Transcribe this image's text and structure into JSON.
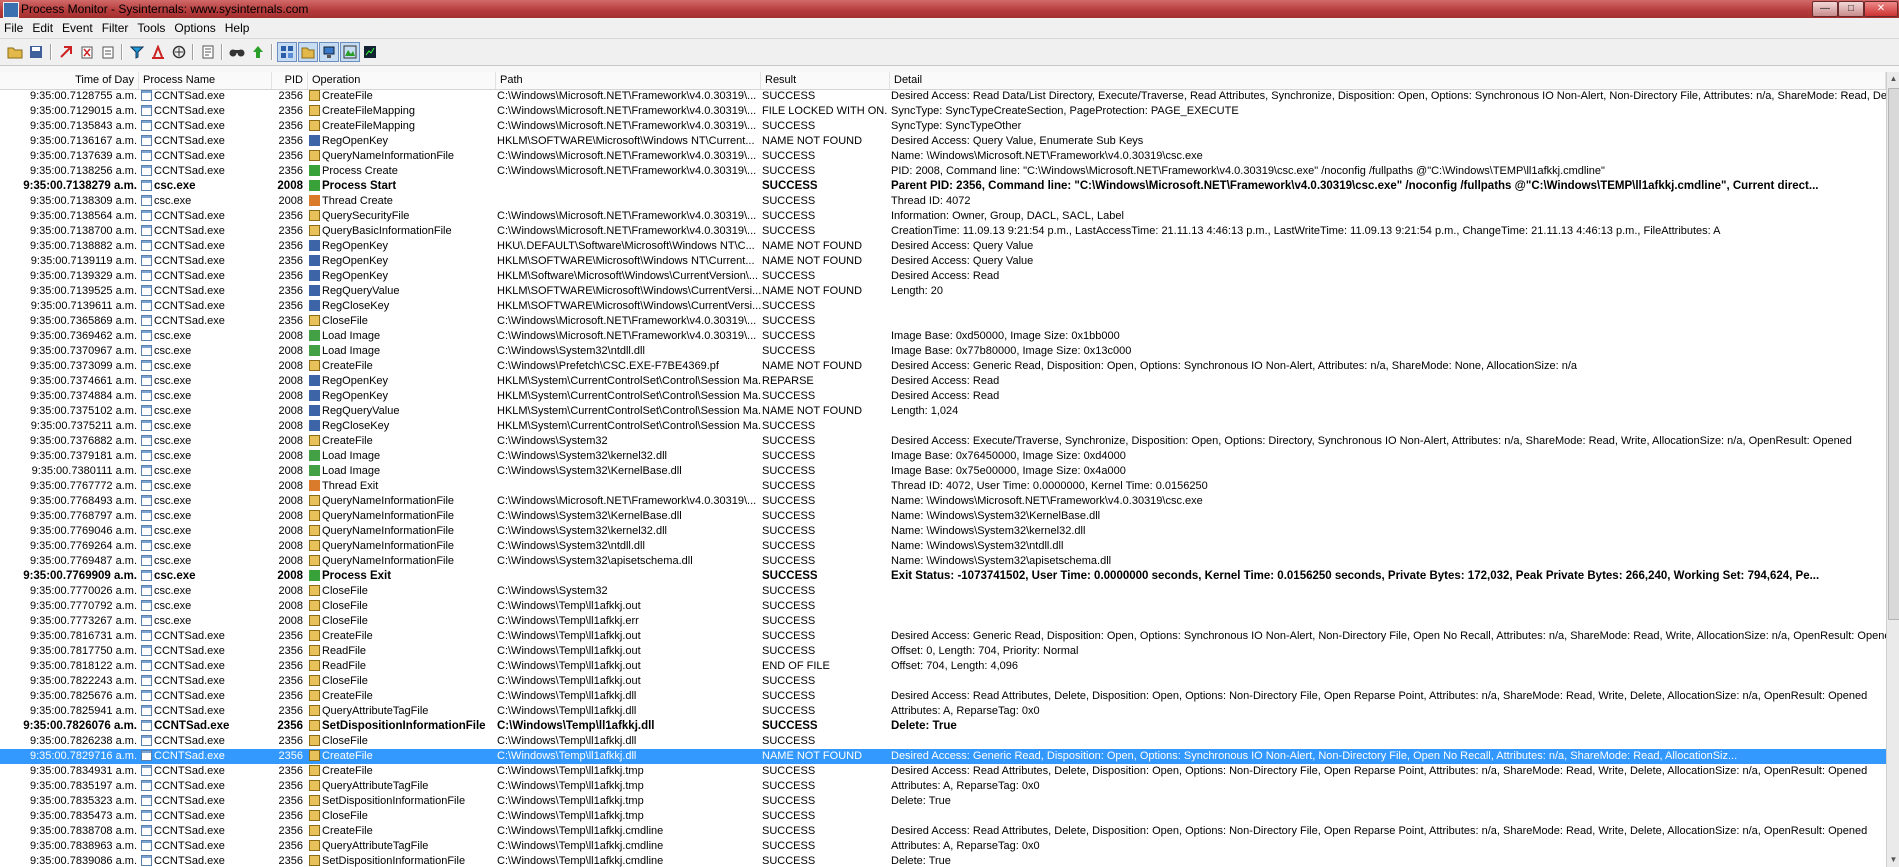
{
  "window": {
    "title": "Process Monitor - Sysinternals: www.sysinternals.com"
  },
  "menu": [
    "File",
    "Edit",
    "Event",
    "Filter",
    "Tools",
    "Options",
    "Help"
  ],
  "columns": {
    "time": "Time of Day",
    "process": "Process Name",
    "pid": "PID",
    "operation": "Operation",
    "path": "Path",
    "result": "Result",
    "detail": "Detail"
  },
  "toolbar": [
    "open-icon",
    "save-icon",
    "autoscroll-icon",
    "clear-icon",
    "filter-icon",
    "highlight-icon",
    "include-icon",
    "jump-icon",
    "find-icon",
    "jump-to-icon",
    "registry-icon",
    "filesystem-icon",
    "network-icon",
    "process-icon",
    "profiling-icon"
  ],
  "colors": {
    "selected_row": "#3399ff",
    "titlebar": "#b53a3a"
  },
  "rows": [
    {
      "time": "9:35:00.7128755 a.m.",
      "process": "CCNTSad.exe",
      "pid": "2356",
      "op": "CreateFile",
      "opIcon": "file",
      "path": "C:\\Windows\\Microsoft.NET\\Framework\\v4.0.30319\\...",
      "result": "SUCCESS",
      "detail": "Desired Access: Read Data/List Directory, Execute/Traverse, Read Attributes, Synchronize, Disposition: Open, Options: Synchronous IO Non-Alert, Non-Directory File, Attributes: n/a, ShareMode: Read, Delete..."
    },
    {
      "time": "9:35:00.7129015 a.m.",
      "process": "CCNTSad.exe",
      "pid": "2356",
      "op": "CreateFileMapping",
      "opIcon": "file",
      "path": "C:\\Windows\\Microsoft.NET\\Framework\\v4.0.30319\\...",
      "result": "FILE LOCKED WITH ON...",
      "detail": "SyncType: SyncTypeCreateSection, PageProtection: PAGE_EXECUTE"
    },
    {
      "time": "9:35:00.7135843 a.m.",
      "process": "CCNTSad.exe",
      "pid": "2356",
      "op": "CreateFileMapping",
      "opIcon": "file",
      "path": "C:\\Windows\\Microsoft.NET\\Framework\\v4.0.30319\\...",
      "result": "SUCCESS",
      "detail": "SyncType: SyncTypeOther"
    },
    {
      "time": "9:35:00.7136167 a.m.",
      "process": "CCNTSad.exe",
      "pid": "2356",
      "op": "RegOpenKey",
      "opIcon": "reg",
      "path": "HKLM\\SOFTWARE\\Microsoft\\Windows NT\\Current...",
      "result": "NAME NOT FOUND",
      "detail": "Desired Access: Query Value, Enumerate Sub Keys"
    },
    {
      "time": "9:35:00.7137639 a.m.",
      "process": "CCNTSad.exe",
      "pid": "2356",
      "op": "QueryNameInformationFile",
      "opIcon": "file",
      "path": "C:\\Windows\\Microsoft.NET\\Framework\\v4.0.30319\\...",
      "result": "SUCCESS",
      "detail": "Name: \\Windows\\Microsoft.NET\\Framework\\v4.0.30319\\csc.exe"
    },
    {
      "time": "9:35:00.7138256 a.m.",
      "process": "CCNTSad.exe",
      "pid": "2356",
      "op": "Process Create",
      "opIcon": "proc",
      "path": "C:\\Windows\\Microsoft.NET\\Framework\\v4.0.30319\\...",
      "result": "SUCCESS",
      "detail": "PID: 2008, Command line: \"C:\\Windows\\Microsoft.NET\\Framework\\v4.0.30319\\csc.exe\" /noconfig /fullpaths @\"C:\\Windows\\TEMP\\ll1afkkj.cmdline\""
    },
    {
      "time": "9:35:00.7138279 a.m.",
      "process": "csc.exe",
      "pid": "2008",
      "op": "Process Start",
      "opIcon": "proc",
      "path": "",
      "result": "SUCCESS",
      "detail": "Parent PID: 2356, Command line: \"C:\\Windows\\Microsoft.NET\\Framework\\v4.0.30319\\csc.exe\" /noconfig /fullpaths @\"C:\\Windows\\TEMP\\ll1afkkj.cmdline\", Current direct...",
      "bold": true
    },
    {
      "time": "9:35:00.7138309 a.m.",
      "process": "csc.exe",
      "pid": "2008",
      "op": "Thread Create",
      "opIcon": "thread",
      "path": "",
      "result": "SUCCESS",
      "detail": "Thread ID: 4072"
    },
    {
      "time": "9:35:00.7138564 a.m.",
      "process": "CCNTSad.exe",
      "pid": "2356",
      "op": "QuerySecurityFile",
      "opIcon": "file",
      "path": "C:\\Windows\\Microsoft.NET\\Framework\\v4.0.30319\\...",
      "result": "SUCCESS",
      "detail": "Information: Owner, Group, DACL, SACL, Label"
    },
    {
      "time": "9:35:00.7138700 a.m.",
      "process": "CCNTSad.exe",
      "pid": "2356",
      "op": "QueryBasicInformationFile",
      "opIcon": "file",
      "path": "C:\\Windows\\Microsoft.NET\\Framework\\v4.0.30319\\...",
      "result": "SUCCESS",
      "detail": "CreationTime: 11.09.13 9:21:54 p.m., LastAccessTime: 21.11.13 4:46:13 p.m., LastWriteTime: 11.09.13 9:21:54 p.m., ChangeTime: 21.11.13 4:46:13 p.m., FileAttributes: A"
    },
    {
      "time": "9:35:00.7138882 a.m.",
      "process": "CCNTSad.exe",
      "pid": "2356",
      "op": "RegOpenKey",
      "opIcon": "reg",
      "path": "HKU\\.DEFAULT\\Software\\Microsoft\\Windows NT\\C...",
      "result": "NAME NOT FOUND",
      "detail": "Desired Access: Query Value"
    },
    {
      "time": "9:35:00.7139119 a.m.",
      "process": "CCNTSad.exe",
      "pid": "2356",
      "op": "RegOpenKey",
      "opIcon": "reg",
      "path": "HKLM\\SOFTWARE\\Microsoft\\Windows NT\\Current...",
      "result": "NAME NOT FOUND",
      "detail": "Desired Access: Query Value"
    },
    {
      "time": "9:35:00.7139329 a.m.",
      "process": "CCNTSad.exe",
      "pid": "2356",
      "op": "RegOpenKey",
      "opIcon": "reg",
      "path": "HKLM\\Software\\Microsoft\\Windows\\CurrentVersion\\...",
      "result": "SUCCESS",
      "detail": "Desired Access: Read"
    },
    {
      "time": "9:35:00.7139525 a.m.",
      "process": "CCNTSad.exe",
      "pid": "2356",
      "op": "RegQueryValue",
      "opIcon": "reg",
      "path": "HKLM\\SOFTWARE\\Microsoft\\Windows\\CurrentVersi...",
      "result": "NAME NOT FOUND",
      "detail": "Length: 20"
    },
    {
      "time": "9:35:00.7139611 a.m.",
      "process": "CCNTSad.exe",
      "pid": "2356",
      "op": "RegCloseKey",
      "opIcon": "reg",
      "path": "HKLM\\SOFTWARE\\Microsoft\\Windows\\CurrentVersi...",
      "result": "SUCCESS",
      "detail": ""
    },
    {
      "time": "9:35:00.7365869 a.m.",
      "process": "CCNTSad.exe",
      "pid": "2356",
      "op": "CloseFile",
      "opIcon": "file",
      "path": "C:\\Windows\\Microsoft.NET\\Framework\\v4.0.30319\\...",
      "result": "SUCCESS",
      "detail": ""
    },
    {
      "time": "9:35:00.7369462 a.m.",
      "process": "csc.exe",
      "pid": "2008",
      "op": "Load Image",
      "opIcon": "img",
      "path": "C:\\Windows\\Microsoft.NET\\Framework\\v4.0.30319\\...",
      "result": "SUCCESS",
      "detail": "Image Base: 0xd50000, Image Size: 0x1bb000"
    },
    {
      "time": "9:35:00.7370967 a.m.",
      "process": "csc.exe",
      "pid": "2008",
      "op": "Load Image",
      "opIcon": "img",
      "path": "C:\\Windows\\System32\\ntdll.dll",
      "result": "SUCCESS",
      "detail": "Image Base: 0x77b80000, Image Size: 0x13c000"
    },
    {
      "time": "9:35:00.7373099 a.m.",
      "process": "csc.exe",
      "pid": "2008",
      "op": "CreateFile",
      "opIcon": "file",
      "path": "C:\\Windows\\Prefetch\\CSC.EXE-F7BE4369.pf",
      "result": "NAME NOT FOUND",
      "detail": "Desired Access: Generic Read, Disposition: Open, Options: Synchronous IO Non-Alert, Attributes: n/a, ShareMode: None, AllocationSize: n/a"
    },
    {
      "time": "9:35:00.7374661 a.m.",
      "process": "csc.exe",
      "pid": "2008",
      "op": "RegOpenKey",
      "opIcon": "reg",
      "path": "HKLM\\System\\CurrentControlSet\\Control\\Session Ma...",
      "result": "REPARSE",
      "detail": "Desired Access: Read"
    },
    {
      "time": "9:35:00.7374884 a.m.",
      "process": "csc.exe",
      "pid": "2008",
      "op": "RegOpenKey",
      "opIcon": "reg",
      "path": "HKLM\\System\\CurrentControlSet\\Control\\Session Ma...",
      "result": "SUCCESS",
      "detail": "Desired Access: Read"
    },
    {
      "time": "9:35:00.7375102 a.m.",
      "process": "csc.exe",
      "pid": "2008",
      "op": "RegQueryValue",
      "opIcon": "reg",
      "path": "HKLM\\System\\CurrentControlSet\\Control\\Session Ma...",
      "result": "NAME NOT FOUND",
      "detail": "Length: 1,024"
    },
    {
      "time": "9:35:00.7375211 a.m.",
      "process": "csc.exe",
      "pid": "2008",
      "op": "RegCloseKey",
      "opIcon": "reg",
      "path": "HKLM\\System\\CurrentControlSet\\Control\\Session Ma...",
      "result": "SUCCESS",
      "detail": ""
    },
    {
      "time": "9:35:00.7376882 a.m.",
      "process": "csc.exe",
      "pid": "2008",
      "op": "CreateFile",
      "opIcon": "file",
      "path": "C:\\Windows\\System32",
      "result": "SUCCESS",
      "detail": "Desired Access: Execute/Traverse, Synchronize, Disposition: Open, Options: Directory, Synchronous IO Non-Alert, Attributes: n/a, ShareMode: Read, Write, AllocationSize: n/a, OpenResult: Opened"
    },
    {
      "time": "9:35:00.7379181 a.m.",
      "process": "csc.exe",
      "pid": "2008",
      "op": "Load Image",
      "opIcon": "img",
      "path": "C:\\Windows\\System32\\kernel32.dll",
      "result": "SUCCESS",
      "detail": "Image Base: 0x76450000, Image Size: 0xd4000"
    },
    {
      "time": "9:35:00.7380111 a.m.",
      "process": "csc.exe",
      "pid": "2008",
      "op": "Load Image",
      "opIcon": "img",
      "path": "C:\\Windows\\System32\\KernelBase.dll",
      "result": "SUCCESS",
      "detail": "Image Base: 0x75e00000, Image Size: 0x4a000"
    },
    {
      "time": "9:35:00.7767772 a.m.",
      "process": "csc.exe",
      "pid": "2008",
      "op": "Thread Exit",
      "opIcon": "thread",
      "path": "",
      "result": "SUCCESS",
      "detail": "Thread ID: 4072, User Time: 0.0000000, Kernel Time: 0.0156250"
    },
    {
      "time": "9:35:00.7768493 a.m.",
      "process": "csc.exe",
      "pid": "2008",
      "op": "QueryNameInformationFile",
      "opIcon": "file",
      "path": "C:\\Windows\\Microsoft.NET\\Framework\\v4.0.30319\\...",
      "result": "SUCCESS",
      "detail": "Name: \\Windows\\Microsoft.NET\\Framework\\v4.0.30319\\csc.exe"
    },
    {
      "time": "9:35:00.7768797 a.m.",
      "process": "csc.exe",
      "pid": "2008",
      "op": "QueryNameInformationFile",
      "opIcon": "file",
      "path": "C:\\Windows\\System32\\KernelBase.dll",
      "result": "SUCCESS",
      "detail": "Name: \\Windows\\System32\\KernelBase.dll"
    },
    {
      "time": "9:35:00.7769046 a.m.",
      "process": "csc.exe",
      "pid": "2008",
      "op": "QueryNameInformationFile",
      "opIcon": "file",
      "path": "C:\\Windows\\System32\\kernel32.dll",
      "result": "SUCCESS",
      "detail": "Name: \\Windows\\System32\\kernel32.dll"
    },
    {
      "time": "9:35:00.7769264 a.m.",
      "process": "csc.exe",
      "pid": "2008",
      "op": "QueryNameInformationFile",
      "opIcon": "file",
      "path": "C:\\Windows\\System32\\ntdll.dll",
      "result": "SUCCESS",
      "detail": "Name: \\Windows\\System32\\ntdll.dll"
    },
    {
      "time": "9:35:00.7769487 a.m.",
      "process": "csc.exe",
      "pid": "2008",
      "op": "QueryNameInformationFile",
      "opIcon": "file",
      "path": "C:\\Windows\\System32\\apisetschema.dll",
      "result": "SUCCESS",
      "detail": "Name: \\Windows\\System32\\apisetschema.dll"
    },
    {
      "time": "9:35:00.7769909 a.m.",
      "process": "csc.exe",
      "pid": "2008",
      "op": "Process Exit",
      "opIcon": "proc",
      "path": "",
      "result": "SUCCESS",
      "detail": "Exit Status: -1073741502, User Time: 0.0000000 seconds, Kernel Time: 0.0156250 seconds, Private Bytes: 172,032, Peak Private Bytes: 266,240, Working Set: 794,624, Pe...",
      "bold": true
    },
    {
      "time": "9:35:00.7770026 a.m.",
      "process": "csc.exe",
      "pid": "2008",
      "op": "CloseFile",
      "opIcon": "file",
      "path": "C:\\Windows\\System32",
      "result": "SUCCESS",
      "detail": ""
    },
    {
      "time": "9:35:00.7770792 a.m.",
      "process": "csc.exe",
      "pid": "2008",
      "op": "CloseFile",
      "opIcon": "file",
      "path": "C:\\Windows\\Temp\\ll1afkkj.out",
      "result": "SUCCESS",
      "detail": ""
    },
    {
      "time": "9:35:00.7773267 a.m.",
      "process": "csc.exe",
      "pid": "2008",
      "op": "CloseFile",
      "opIcon": "file",
      "path": "C:\\Windows\\Temp\\ll1afkkj.err",
      "result": "SUCCESS",
      "detail": ""
    },
    {
      "time": "9:35:00.7816731 a.m.",
      "process": "CCNTSad.exe",
      "pid": "2356",
      "op": "CreateFile",
      "opIcon": "file",
      "path": "C:\\Windows\\Temp\\ll1afkkj.out",
      "result": "SUCCESS",
      "detail": "Desired Access: Generic Read, Disposition: Open, Options: Synchronous IO Non-Alert, Non-Directory File, Open No Recall, Attributes: n/a, ShareMode: Read, Write, AllocationSize: n/a, OpenResult: Opened"
    },
    {
      "time": "9:35:00.7817750 a.m.",
      "process": "CCNTSad.exe",
      "pid": "2356",
      "op": "ReadFile",
      "opIcon": "file",
      "path": "C:\\Windows\\Temp\\ll1afkkj.out",
      "result": "SUCCESS",
      "detail": "Offset: 0, Length: 704, Priority: Normal"
    },
    {
      "time": "9:35:00.7818122 a.m.",
      "process": "CCNTSad.exe",
      "pid": "2356",
      "op": "ReadFile",
      "opIcon": "file",
      "path": "C:\\Windows\\Temp\\ll1afkkj.out",
      "result": "END OF FILE",
      "detail": "Offset: 704, Length: 4,096"
    },
    {
      "time": "9:35:00.7822243 a.m.",
      "process": "CCNTSad.exe",
      "pid": "2356",
      "op": "CloseFile",
      "opIcon": "file",
      "path": "C:\\Windows\\Temp\\ll1afkkj.out",
      "result": "SUCCESS",
      "detail": ""
    },
    {
      "time": "9:35:00.7825676 a.m.",
      "process": "CCNTSad.exe",
      "pid": "2356",
      "op": "CreateFile",
      "opIcon": "file",
      "path": "C:\\Windows\\Temp\\ll1afkkj.dll",
      "result": "SUCCESS",
      "detail": "Desired Access: Read Attributes, Delete, Disposition: Open, Options: Non-Directory File, Open Reparse Point, Attributes: n/a, ShareMode: Read, Write, Delete, AllocationSize: n/a, OpenResult: Opened"
    },
    {
      "time": "9:35:00.7825941 a.m.",
      "process": "CCNTSad.exe",
      "pid": "2356",
      "op": "QueryAttributeTagFile",
      "opIcon": "file",
      "path": "C:\\Windows\\Temp\\ll1afkkj.dll",
      "result": "SUCCESS",
      "detail": "Attributes: A, ReparseTag: 0x0"
    },
    {
      "time": "9:35:00.7826076 a.m.",
      "process": "CCNTSad.exe",
      "pid": "2356",
      "op": "SetDispositionInformationFile",
      "opIcon": "file",
      "path": "C:\\Windows\\Temp\\ll1afkkj.dll",
      "result": "SUCCESS",
      "detail": "Delete: True",
      "bold": true
    },
    {
      "time": "9:35:00.7826238 a.m.",
      "process": "CCNTSad.exe",
      "pid": "2356",
      "op": "CloseFile",
      "opIcon": "file",
      "path": "C:\\Windows\\Temp\\ll1afkkj.dll",
      "result": "SUCCESS",
      "detail": ""
    },
    {
      "time": "9:35:00.7829716 a.m.",
      "process": "CCNTSad.exe",
      "pid": "2356",
      "op": "CreateFile",
      "opIcon": "file",
      "path": "C:\\Windows\\Temp\\ll1afkkj.dll",
      "result": "NAME NOT FOUND",
      "detail": "Desired Access: Generic Read, Disposition: Open, Options: Synchronous IO Non-Alert, Non-Directory File, Open No Recall, Attributes: n/a, ShareMode: Read, AllocationSiz...",
      "selected": true
    },
    {
      "time": "9:35:00.7834931 a.m.",
      "process": "CCNTSad.exe",
      "pid": "2356",
      "op": "CreateFile",
      "opIcon": "file",
      "path": "C:\\Windows\\Temp\\ll1afkkj.tmp",
      "result": "SUCCESS",
      "detail": "Desired Access: Read Attributes, Delete, Disposition: Open, Options: Non-Directory File, Open Reparse Point, Attributes: n/a, ShareMode: Read, Write, Delete, AllocationSize: n/a, OpenResult: Opened"
    },
    {
      "time": "9:35:00.7835197 a.m.",
      "process": "CCNTSad.exe",
      "pid": "2356",
      "op": "QueryAttributeTagFile",
      "opIcon": "file",
      "path": "C:\\Windows\\Temp\\ll1afkkj.tmp",
      "result": "SUCCESS",
      "detail": "Attributes: A, ReparseTag: 0x0"
    },
    {
      "time": "9:35:00.7835323 a.m.",
      "process": "CCNTSad.exe",
      "pid": "2356",
      "op": "SetDispositionInformationFile",
      "opIcon": "file",
      "path": "C:\\Windows\\Temp\\ll1afkkj.tmp",
      "result": "SUCCESS",
      "detail": "Delete: True"
    },
    {
      "time": "9:35:00.7835473 a.m.",
      "process": "CCNTSad.exe",
      "pid": "2356",
      "op": "CloseFile",
      "opIcon": "file",
      "path": "C:\\Windows\\Temp\\ll1afkkj.tmp",
      "result": "SUCCESS",
      "detail": ""
    },
    {
      "time": "9:35:00.7838708 a.m.",
      "process": "CCNTSad.exe",
      "pid": "2356",
      "op": "CreateFile",
      "opIcon": "file",
      "path": "C:\\Windows\\Temp\\ll1afkkj.cmdline",
      "result": "SUCCESS",
      "detail": "Desired Access: Read Attributes, Delete, Disposition: Open, Options: Non-Directory File, Open Reparse Point, Attributes: n/a, ShareMode: Read, Write, Delete, AllocationSize: n/a, OpenResult: Opened"
    },
    {
      "time": "9:35:00.7838963 a.m.",
      "process": "CCNTSad.exe",
      "pid": "2356",
      "op": "QueryAttributeTagFile",
      "opIcon": "file",
      "path": "C:\\Windows\\Temp\\ll1afkkj.cmdline",
      "result": "SUCCESS",
      "detail": "Attributes: A, ReparseTag: 0x0"
    },
    {
      "time": "9:35:00.7839086 a.m.",
      "process": "CCNTSad.exe",
      "pid": "2356",
      "op": "SetDispositionInformationFile",
      "opIcon": "file",
      "path": "C:\\Windows\\Temp\\ll1afkkj.cmdline",
      "result": "SUCCESS",
      "detail": "Delete: True"
    }
  ]
}
